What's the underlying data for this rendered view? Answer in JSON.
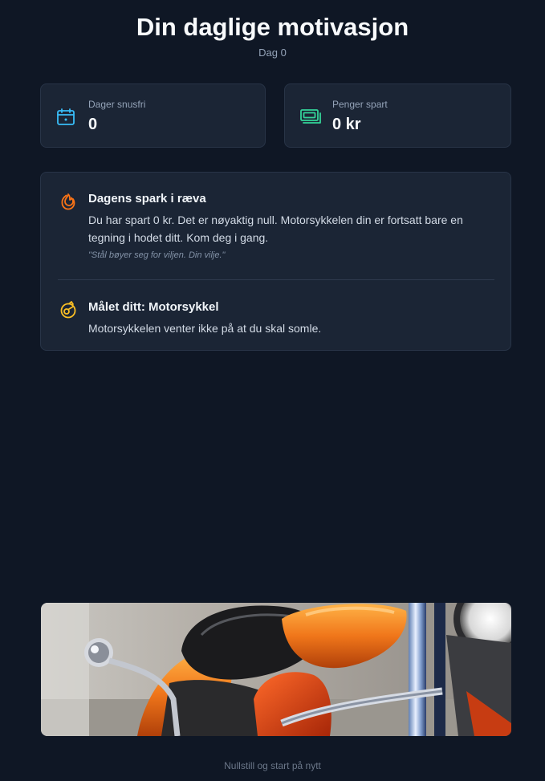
{
  "header": {
    "title": "Din daglige motivasjon",
    "subtitle": "Dag 0"
  },
  "stats": {
    "days": {
      "label": "Dager snusfri",
      "value": "0",
      "icon": "calendar-icon",
      "color": "#38bdf8"
    },
    "money": {
      "label": "Penger spart",
      "value": "0 kr",
      "icon": "money-icon",
      "color": "#34d399"
    }
  },
  "motivation": {
    "kick": {
      "title": "Dagens spark i ræva",
      "text": "Du har spart 0 kr. Det er nøyaktig null. Motorsykkelen din er fortsatt bare en tegning i hodet ditt. Kom deg i gang.",
      "quote": "\"Stål bøyer seg for viljen. Din vilje.\"",
      "icon": "flame-icon",
      "color": "#f97316"
    },
    "goal": {
      "title": "Målet ditt: Motorsykkel",
      "text": "Motorsykkelen venter ikke på at du skal somle.",
      "icon": "goal-icon",
      "color": "#fbbf24"
    }
  },
  "footer": {
    "reset_label": "Nullstill og start på nytt"
  },
  "colors": {
    "background": "#0f1725",
    "card": "#1b2535",
    "border": "#283447"
  }
}
